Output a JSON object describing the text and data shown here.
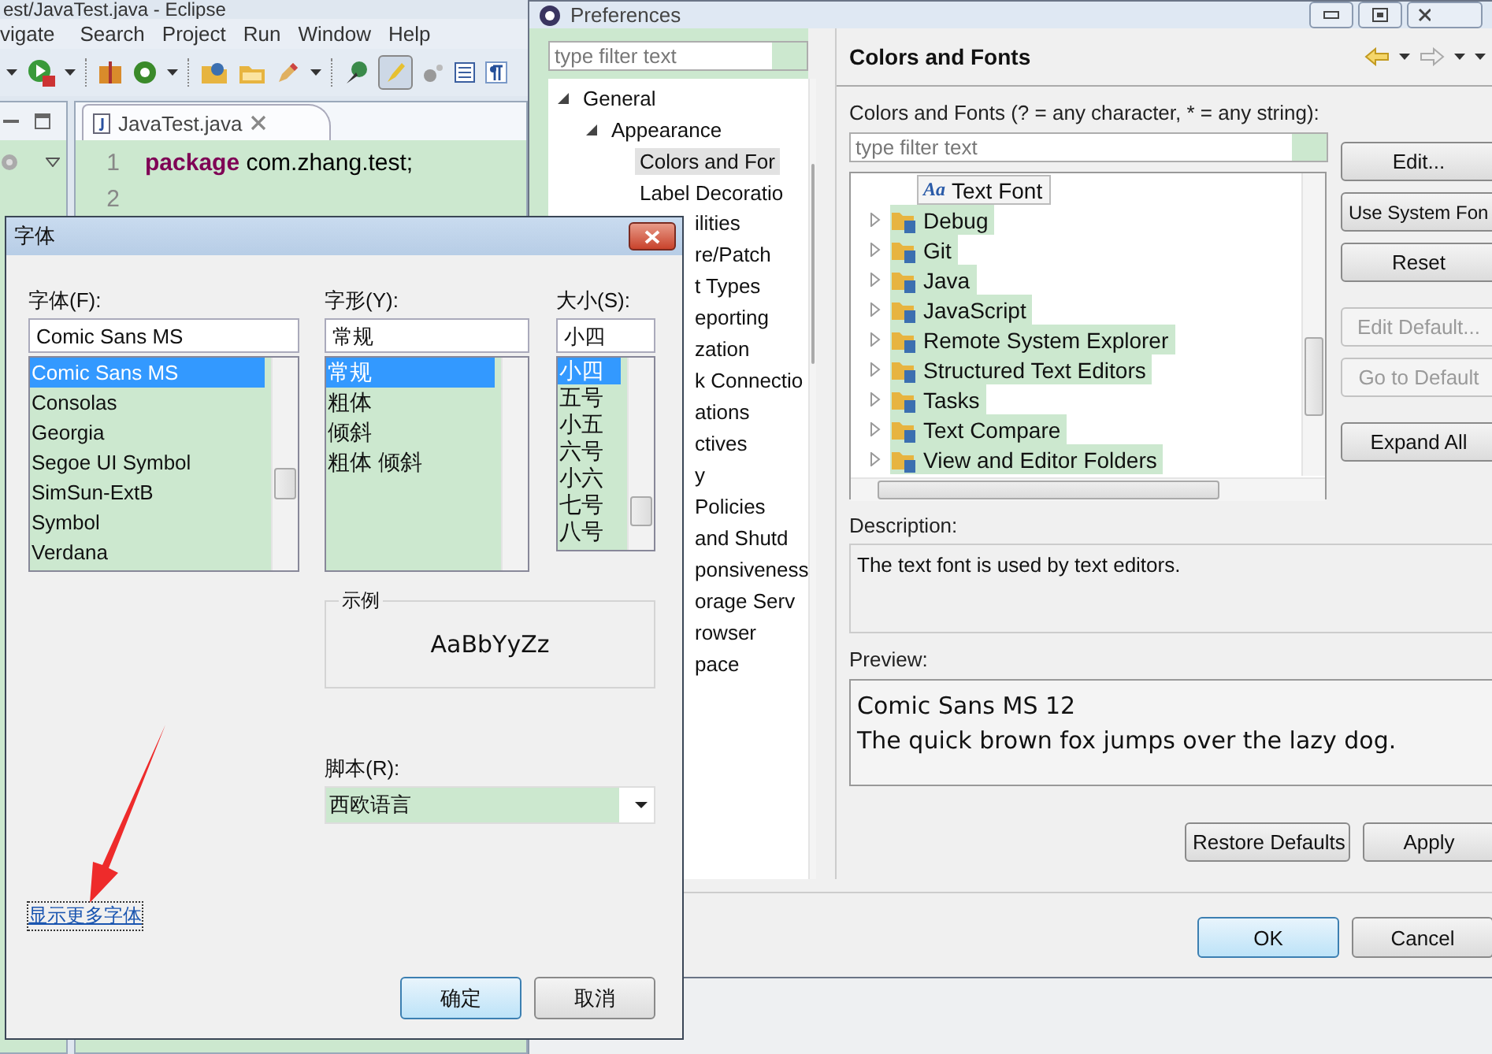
{
  "eclipse": {
    "title": "est/JavaTest.java - Eclipse",
    "menu": [
      "vigate",
      "Search",
      "Project",
      "Run",
      "Window",
      "Help"
    ],
    "editor_tab": {
      "label": "JavaTest.java",
      "selected": true
    },
    "code_lines": [
      {
        "number": "1",
        "text": "**package** com.zhang.test;"
      },
      {
        "number": "2"
      }
    ]
  },
  "preferences": {
    "title": "Preferences",
    "filter": {
      "placeholder": "type filter text"
    },
    "tree": [
      {
        "label": "General",
        "expanded": true,
        "selected": false,
        "children": [
          {
            "label": "Appearance",
            "expanded": true,
            "selected": false,
            "children": [
              {
                "label": "Colors and For",
                "selected": true
              },
              {
                "label": "Label Decoratio",
                "selected": false
              }
            ]
          }
        ]
      }
    ],
    "tree_partial": [
      "ilities",
      "re/Patch",
      "t Types",
      "eporting",
      "zation",
      "k Connectio",
      "ations",
      "ctives",
      "y",
      "Policies",
      "and Shutd",
      "ponsiveness",
      "orage Serv",
      "rowser",
      "pace"
    ],
    "page": {
      "title": "Colors and Fonts",
      "filter_label": "Colors and Fonts (? = any character, * = any string):",
      "filter": {
        "placeholder": "type filter text"
      },
      "items": [
        {
          "label": "Text Font",
          "kind": "font",
          "glyph": "Aa",
          "selected": true
        },
        {
          "label": "Debug",
          "kind": "category",
          "expanded": false,
          "selected": false
        },
        {
          "label": "Git",
          "kind": "category",
          "expanded": false,
          "selected": false
        },
        {
          "label": "Java",
          "kind": "category",
          "expanded": false,
          "selected": false
        },
        {
          "label": "JavaScript",
          "kind": "category",
          "expanded": false,
          "selected": false
        },
        {
          "label": "Remote System Explorer",
          "kind": "category",
          "expanded": false,
          "selected": false
        },
        {
          "label": "Structured Text Editors",
          "kind": "category",
          "expanded": false,
          "selected": false
        },
        {
          "label": "Tasks",
          "kind": "category",
          "expanded": false,
          "selected": false
        },
        {
          "label": "Text Compare",
          "kind": "category",
          "expanded": false,
          "selected": false
        },
        {
          "label": "View and Editor Folders",
          "kind": "category",
          "expanded": false,
          "selected": false
        }
      ],
      "side_buttons": [
        {
          "label": "Edit...",
          "disabled": false
        },
        {
          "label": "Use System Fon",
          "disabled": false
        },
        {
          "label": "Reset",
          "disabled": false
        },
        {
          "label": "Edit Default...",
          "disabled": true
        },
        {
          "label": "Go to Default",
          "disabled": true
        },
        {
          "label": "Expand All",
          "disabled": false
        }
      ],
      "description_label": "Description:",
      "description": "The text font is used by text editors.",
      "preview_label": "Preview:",
      "preview": [
        "Comic Sans MS 12",
        "The quick brown fox jumps over the lazy dog."
      ],
      "page_buttons": [
        "Restore Defaults",
        "Apply"
      ]
    },
    "buttons": [
      {
        "label": "OK",
        "default": true
      },
      {
        "label": "Cancel",
        "default": false
      }
    ]
  },
  "font_dialog": {
    "title": "字体",
    "columns": [
      {
        "label": "字体(F):",
        "value": "Comic Sans MS",
        "kind": "font",
        "options": [
          {
            "label": "Comic Sans MS",
            "selected": true
          },
          {
            "label": "Consolas",
            "selected": false
          },
          {
            "label": "Georgia",
            "selected": false
          },
          {
            "label": "Segoe UI Symbol",
            "selected": false
          },
          {
            "label": "SimSun-ExtB",
            "selected": false
          },
          {
            "label": "Symbol",
            "selected": false
          },
          {
            "label": "Verdana",
            "selected": false
          }
        ]
      },
      {
        "label": "字形(Y):",
        "value": "常规",
        "kind": "style",
        "options": [
          {
            "label": "常规",
            "selected": true
          },
          {
            "label": "粗体",
            "selected": false
          },
          {
            "label": "倾斜",
            "selected": false
          },
          {
            "label": "粗体 倾斜",
            "selected": false
          }
        ]
      },
      {
        "label": "大小(S):",
        "value": "小四",
        "kind": "size",
        "options": [
          {
            "label": "小四",
            "selected": true
          },
          {
            "label": "五号",
            "selected": false
          },
          {
            "label": "小五",
            "selected": false
          },
          {
            "label": "六号",
            "selected": false
          },
          {
            "label": "小六",
            "selected": false
          },
          {
            "label": "七号",
            "selected": false
          },
          {
            "label": "八号",
            "selected": false
          }
        ]
      }
    ],
    "sample": {
      "label": "示例",
      "text": "AaBbYyZz"
    },
    "script": {
      "label": "脚本(R):",
      "value": "西欧语言"
    },
    "more_fonts_link": "显示更多字体",
    "buttons": [
      {
        "label": "确定",
        "default": true
      },
      {
        "label": "取消",
        "default": false
      }
    ]
  }
}
